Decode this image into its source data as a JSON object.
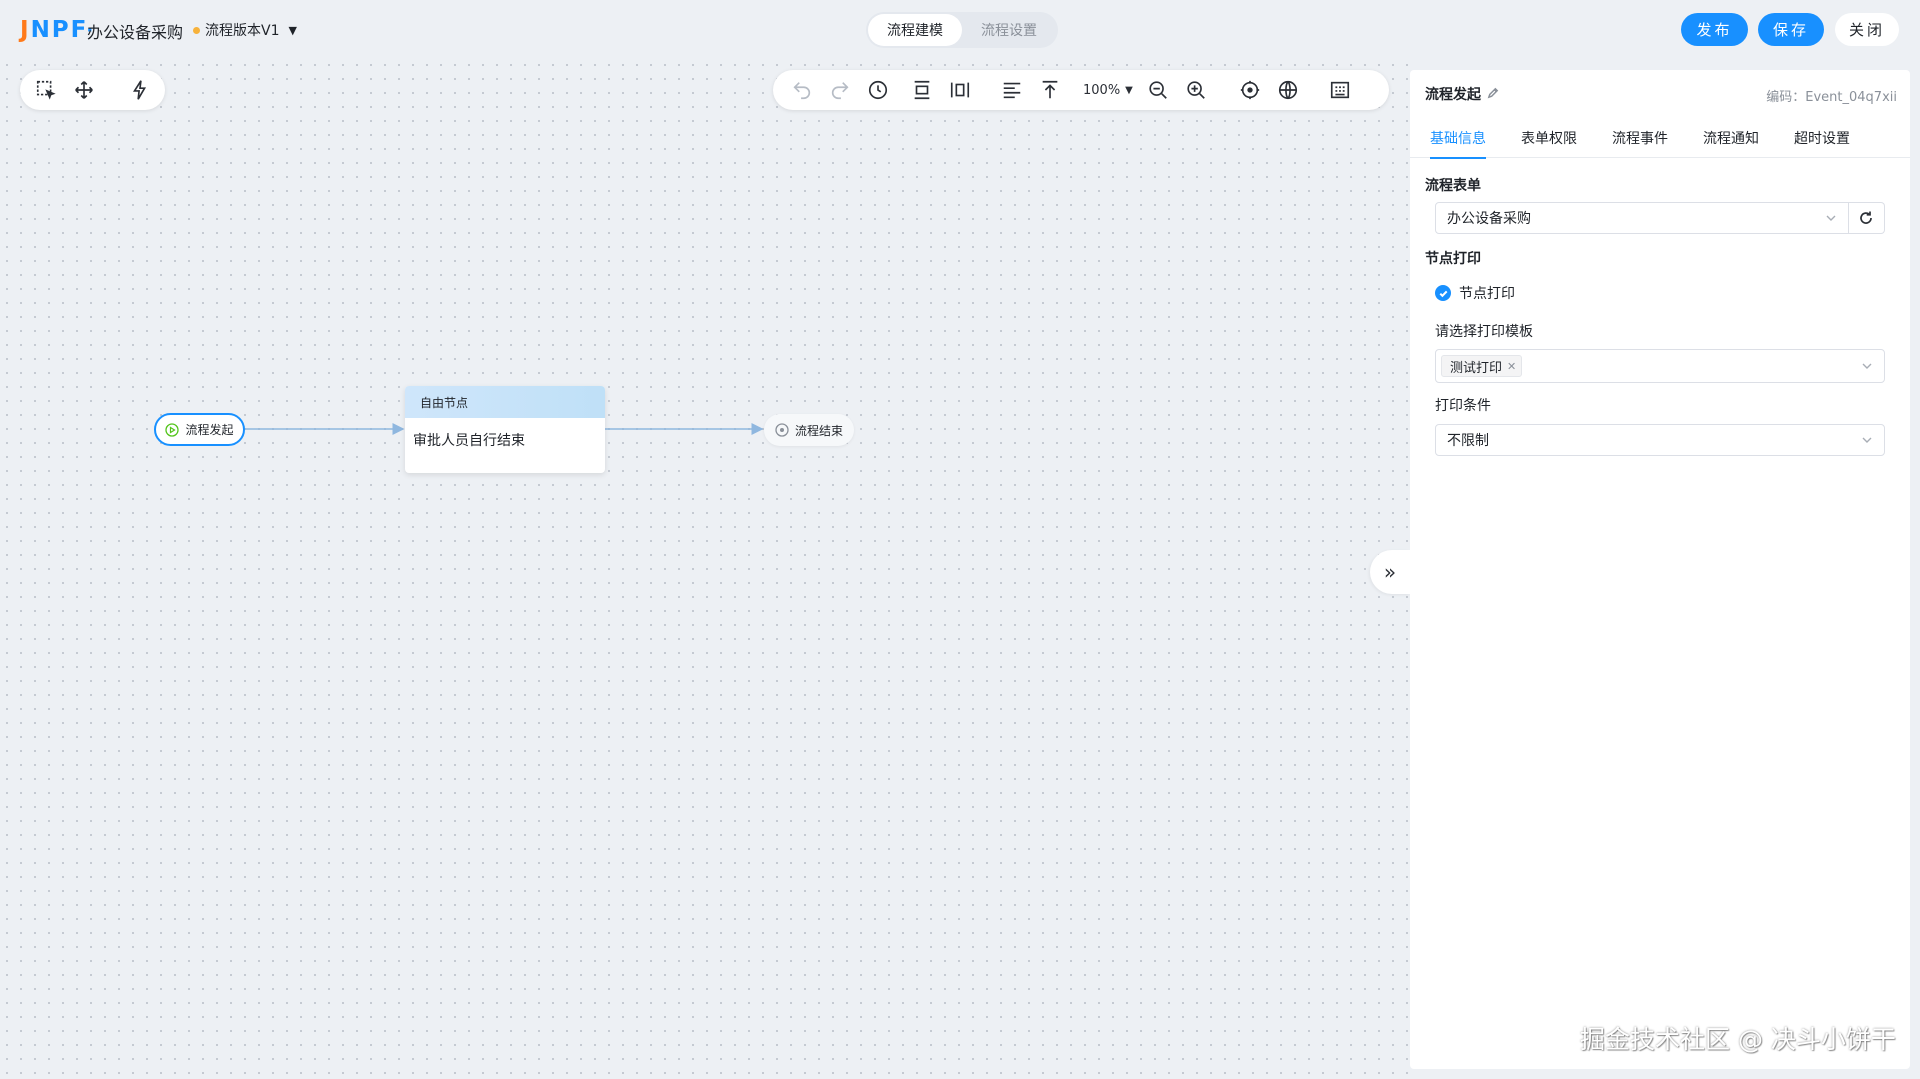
{
  "header": {
    "logo": "JNPF",
    "app_title": "办公设备采购",
    "version_label": "流程版本V1",
    "mode_tabs": [
      {
        "label": "流程建模",
        "active": true
      },
      {
        "label": "流程设置",
        "active": false
      }
    ],
    "buttons": {
      "publish": "发布",
      "save": "保存",
      "close": "关闭"
    }
  },
  "toolbar": {
    "zoom": "100%"
  },
  "flow": {
    "start_node": "流程发起",
    "free_node": {
      "title": "自由节点",
      "body": "审批人员自行结束"
    },
    "end_node": "流程结束"
  },
  "panel": {
    "title": "流程发起",
    "code": "编码：Event_04q7xii",
    "tabs": [
      {
        "label": "基础信息",
        "active": true
      },
      {
        "label": "表单权限",
        "active": false
      },
      {
        "label": "流程事件",
        "active": false
      },
      {
        "label": "流程通知",
        "active": false
      },
      {
        "label": "超时设置",
        "active": false
      }
    ],
    "form_section_title": "流程表单",
    "form_value": "办公设备采购",
    "print_section_title": "节点打印",
    "print_checkbox_label": "节点打印",
    "print_checked": true,
    "template_label": "请选择打印模板",
    "template_tag": "测试打印",
    "condition_label": "打印条件",
    "condition_value": "不限制"
  },
  "watermark": "掘金技术社区 @ 决斗小饼干",
  "colors": {
    "primary": "#1890ff",
    "logo_j": "#ff7a1a",
    "version_dot": "#f7b23b",
    "canvas_bg": "#edf0f4",
    "start_icon": "#52c41a"
  }
}
